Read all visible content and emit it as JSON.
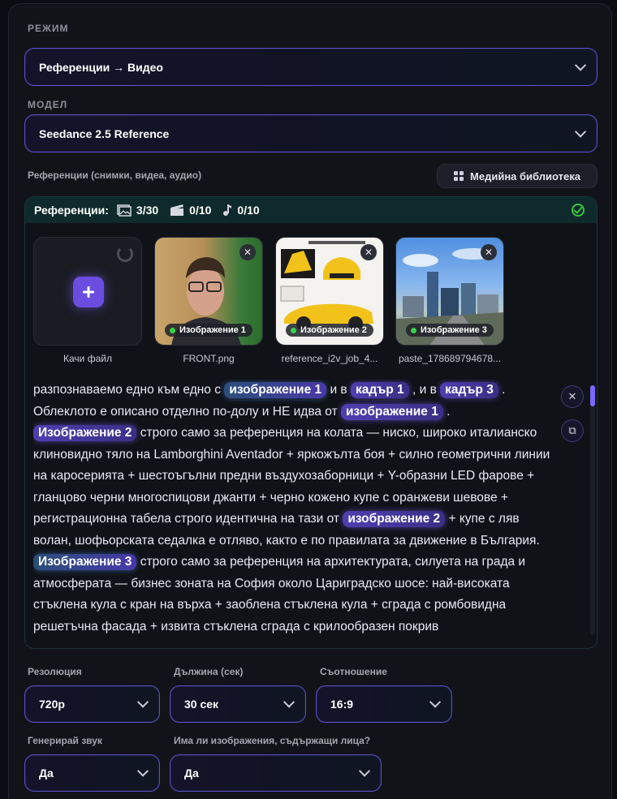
{
  "mode": {
    "label": "РЕЖИМ",
    "value": "Референции → Видео"
  },
  "model": {
    "label": "МОДЕЛ",
    "value": "Seedance 2.5 Reference"
  },
  "references": {
    "section_label": "Референции (снимки, видеа, аудио)",
    "media_library_button": "Медийна библиотека",
    "header_title": "Референции:",
    "image_count": "3/30",
    "video_count": "0/10",
    "audio_count": "0/10",
    "upload_label": "Качи файл",
    "items": [
      {
        "tag": "Изображение 1",
        "filename": "FRONT.png"
      },
      {
        "tag": "Изображение 2",
        "filename": "reference_i2v_job_4..."
      },
      {
        "tag": "Изображение 3",
        "filename": "paste_178689794678..."
      }
    ]
  },
  "prompt": {
    "l1a": "разпознаваемо едно към едно с",
    "chip_img1": "изображение 1",
    "l1b": "и в",
    "chip_kadar1": "кадър 1",
    "l1c": ", и в",
    "chip_kadar3": "кадър 3",
    "l1d": ".",
    "l2a": "Облеклото е описано отделно по-долу и НЕ идва от",
    "chip_img1b": "изображение 1",
    "l2b": ".",
    "chip_img2": "Изображение 2",
    "l3a": "строго само за референция на колата — ниско, широко италианско клиновидно тяло на Lamborghini Aventador + яркожълта боя + силно геометрични линии на каросерията + шестоъгълни предни въздухозаборници + Y-образни LED фарове + гланцово черни многоспицови джанти + черно кожено купе с оранжеви шевове + регистрационна табела строго идентична на тази от",
    "chip_img2b": "изображение 2",
    "l3b": "+ купе с ляв волан, шофьорската седалка е отляво, както е по правилата за движение в България.",
    "chip_img3": "Изображение 3",
    "l4a": "строго само за референция на архитектурата, силуета на града и атмосферата — бизнес зоната на София около Цариградско шосе: най-високата стъклена кула с кран на върха + заоблена стъклена кула + сграда с ромбовидна решетъчна фасада + извита стъклена сграда с крилообразен покрив"
  },
  "resolution": {
    "label": "Резолюция",
    "value": "720p"
  },
  "duration": {
    "label": "Дължина (сек)",
    "value": "30 сек"
  },
  "ratio": {
    "label": "Съотношение",
    "value": "16:9"
  },
  "sound": {
    "label": "Генерирай звук",
    "value": "Да"
  },
  "faces": {
    "label": "Има ли изображения, съдържащи лица?",
    "value": "Да"
  },
  "colors": {
    "accent": "#6b4de0",
    "success": "#3cc43c",
    "border": "#5b4fc8"
  }
}
